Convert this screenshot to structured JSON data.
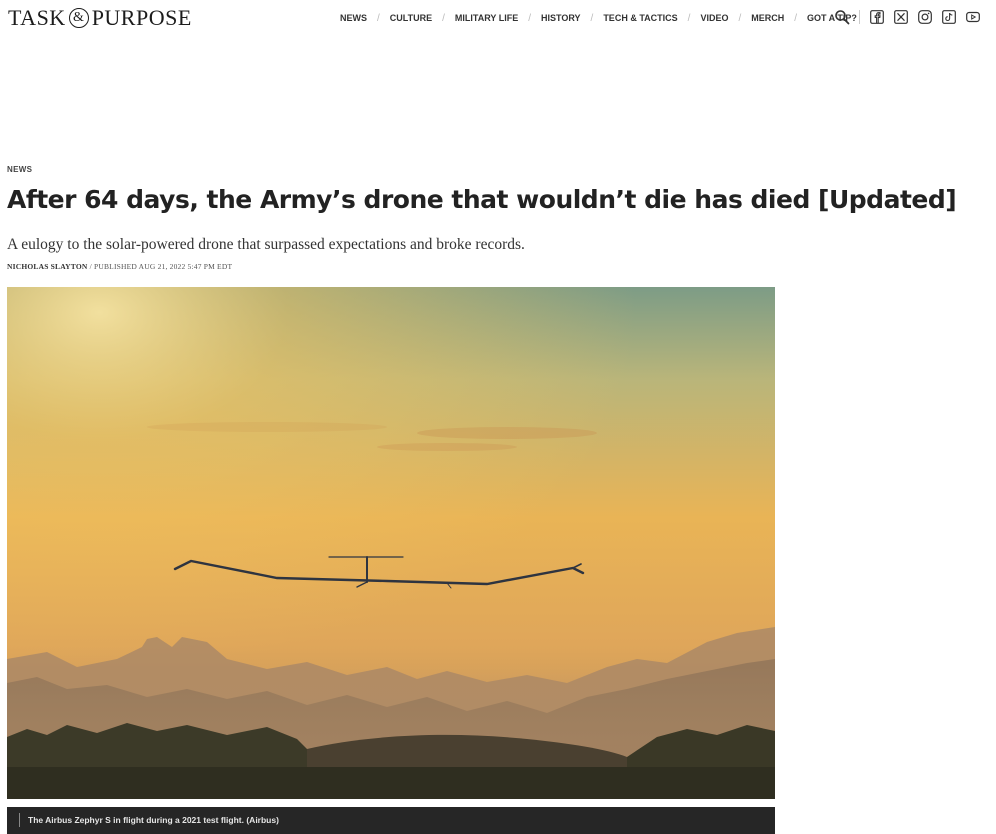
{
  "brand": {
    "word1": "TASK",
    "amp": "&",
    "word2": "PURPOSE"
  },
  "nav": {
    "items": [
      "NEWS",
      "CULTURE",
      "MILITARY LIFE",
      "HISTORY",
      "TECH & TACTICS",
      "VIDEO",
      "MERCH",
      "GOT A TIP?"
    ],
    "separator": "/"
  },
  "icons": {
    "search": "search-icon",
    "social": [
      "facebook-icon",
      "x-icon",
      "instagram-icon",
      "tiktok-icon",
      "youtube-icon"
    ]
  },
  "article": {
    "kicker": "NEWS",
    "headline": "After 64 days, the Army’s drone that wouldn’t die has died [Updated]",
    "dek": "A eulogy to the solar-powered drone that surpassed expectations and broke records.",
    "author": "NICHOLAS SLAYTON",
    "published": "/ PUBLISHED AUG 21, 2022 5:47 PM EDT",
    "caption": "The Airbus Zephyr S in flight during a 2021 test flight. (Airbus)"
  },
  "colors": {
    "sky_top": "#7d9c86",
    "sky_glow": "#f2c461",
    "caption_bg": "#262626"
  }
}
